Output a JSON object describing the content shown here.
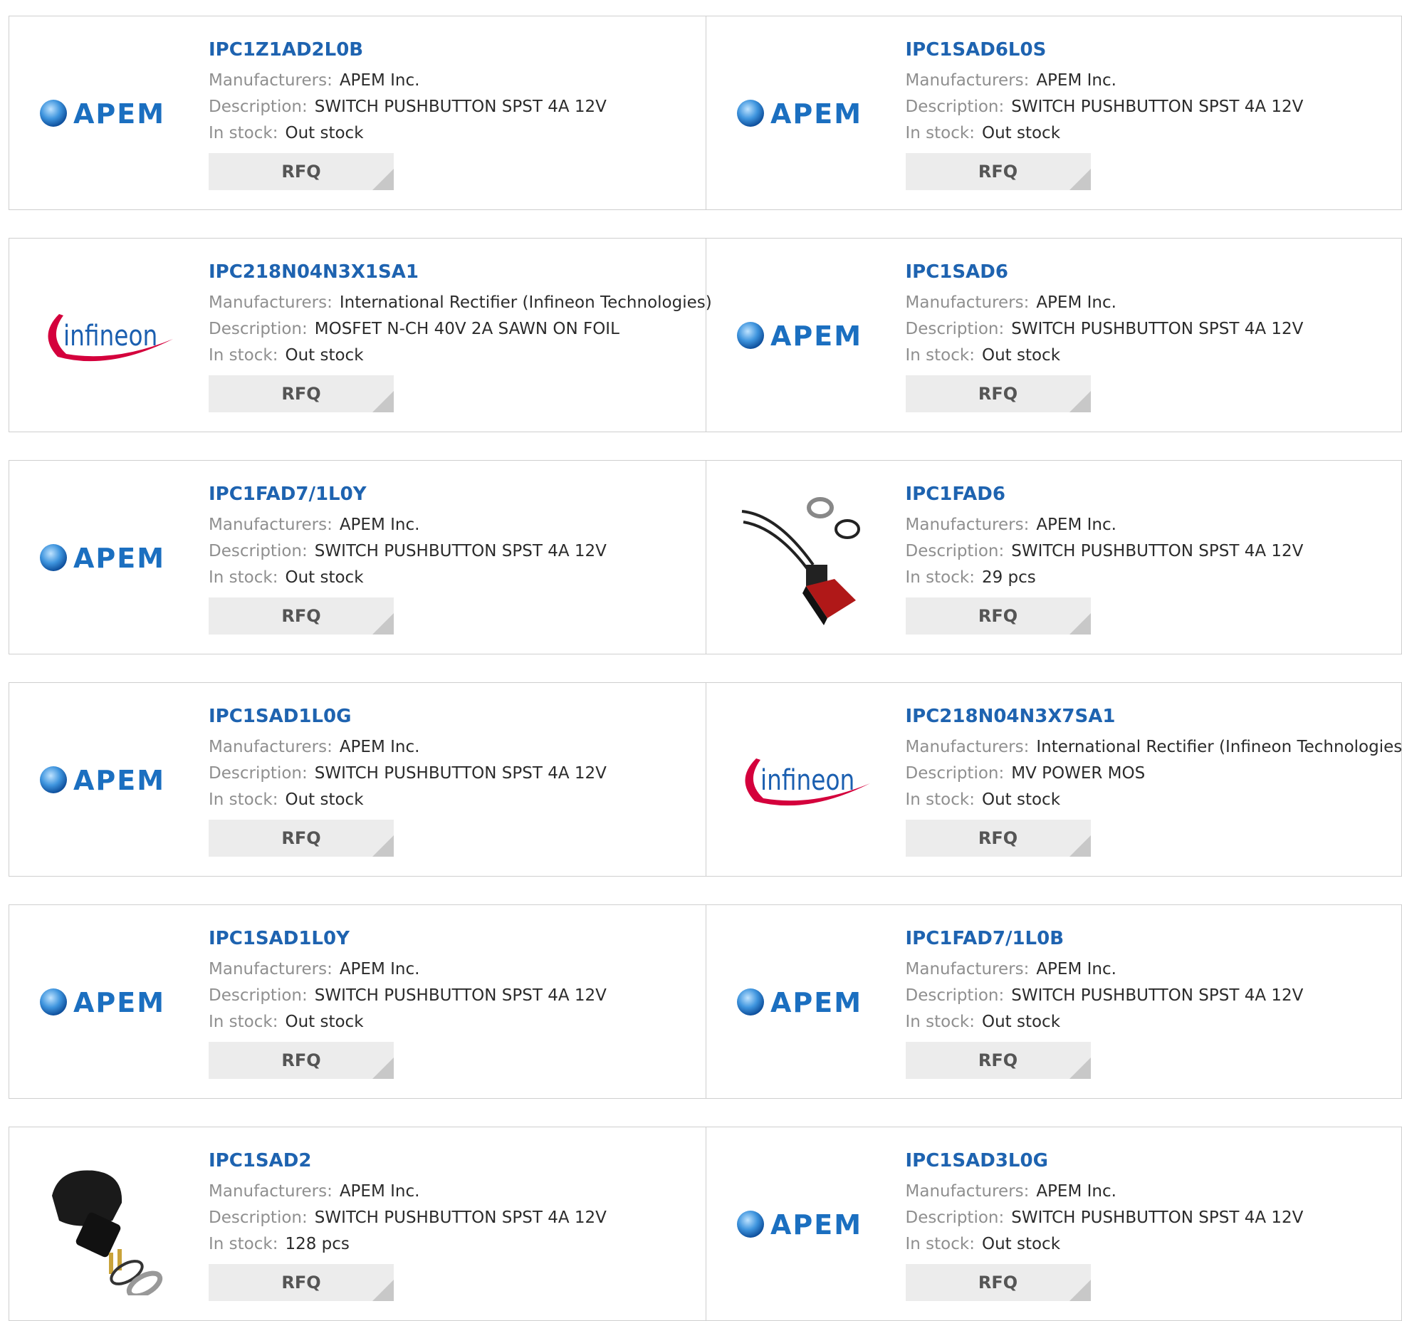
{
  "labels": {
    "manufacturers": "Manufacturers:",
    "description": "Description:",
    "in_stock": "In stock:",
    "rfq": "RFQ"
  },
  "colors": {
    "link": "#1e63b0",
    "apem_blue": "#1b6fc0",
    "infineon_red": "#d4003c",
    "infineon_blue": "#1b5fb0"
  },
  "rows": [
    {
      "cells": [
        {
          "part": "IPC1Z1AD2L0B",
          "manufacturer": "APEM Inc.",
          "description": "SWITCH PUSHBUTTON SPST 4A 12V",
          "stock": "Out stock",
          "logo": "APEM"
        },
        {
          "part": "IPC1SAD6L0S",
          "manufacturer": "APEM Inc.",
          "description": "SWITCH PUSHBUTTON SPST 4A 12V",
          "stock": "Out stock",
          "logo": "APEM"
        }
      ]
    },
    {
      "cells": [
        {
          "part": "IPC218N04N3X1SA1",
          "manufacturer": "International Rectifier (Infineon Technologies)",
          "description": "MOSFET N-CH 40V 2A SAWN ON FOIL",
          "stock": "Out stock",
          "logo": "infineon"
        },
        {
          "part": "IPC1SAD6",
          "manufacturer": "APEM Inc.",
          "description": "SWITCH PUSHBUTTON SPST 4A 12V",
          "stock": "Out stock",
          "logo": "APEM"
        }
      ]
    },
    {
      "cells": [
        {
          "part": "IPC1FAD7/1L0Y",
          "manufacturer": "APEM Inc.",
          "description": "SWITCH PUSHBUTTON SPST 4A 12V",
          "stock": "Out stock",
          "logo": "APEM"
        },
        {
          "part": "IPC1FAD6",
          "manufacturer": "APEM Inc.",
          "description": "SWITCH PUSHBUTTON SPST 4A 12V",
          "stock": "29 pcs",
          "logo": "red-switch-photo"
        }
      ]
    },
    {
      "cells": [
        {
          "part": "IPC1SAD1L0G",
          "manufacturer": "APEM Inc.",
          "description": "SWITCH PUSHBUTTON SPST 4A 12V",
          "stock": "Out stock",
          "logo": "APEM"
        },
        {
          "part": "IPC218N04N3X7SA1",
          "manufacturer": "International Rectifier (Infineon Technologies)",
          "description": "MV POWER MOS",
          "stock": "Out stock",
          "logo": "infineon"
        }
      ]
    },
    {
      "cells": [
        {
          "part": "IPC1SAD1L0Y",
          "manufacturer": "APEM Inc.",
          "description": "SWITCH PUSHBUTTON SPST 4A 12V",
          "stock": "Out stock",
          "logo": "APEM"
        },
        {
          "part": "IPC1FAD7/1L0B",
          "manufacturer": "APEM Inc.",
          "description": "SWITCH PUSHBUTTON SPST 4A 12V",
          "stock": "Out stock",
          "logo": "APEM"
        }
      ]
    },
    {
      "cells": [
        {
          "part": "IPC1SAD2",
          "manufacturer": "APEM Inc.",
          "description": "SWITCH PUSHBUTTON SPST 4A 12V",
          "stock": "128 pcs",
          "logo": "black-switch-photo"
        },
        {
          "part": "IPC1SAD3L0G",
          "manufacturer": "APEM Inc.",
          "description": "SWITCH PUSHBUTTON SPST 4A 12V",
          "stock": "Out stock",
          "logo": "APEM"
        }
      ]
    }
  ]
}
